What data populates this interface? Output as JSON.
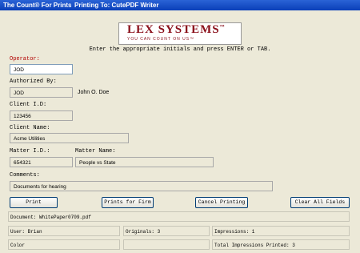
{
  "window": {
    "title": "The Count® For Prints",
    "printing_to": "Printing To: CutePDF Writer"
  },
  "logo": {
    "brand": "LEX SYSTEMS",
    "tm": "™",
    "tagline": "YOU CAN COUNT ON US™"
  },
  "instruction": "Enter the appropriate initials and press ENTER or TAB.",
  "form": {
    "operator": {
      "label": "Operator:",
      "value": "JOD"
    },
    "authorized_by": {
      "label": "Authorized By:",
      "value": "JOD",
      "name": "John O. Doe"
    },
    "client_id": {
      "label": "Client I.D:",
      "value": "123456"
    },
    "client_name": {
      "label": "Client Name:",
      "value": "Acme Utilities"
    },
    "matter_id": {
      "label": "Matter I.D.:",
      "value": "654321"
    },
    "matter_name": {
      "label": "Matter Name:",
      "value": "People vs State"
    },
    "comments": {
      "label": "Comments:",
      "value": "Documents for hearing"
    }
  },
  "buttons": {
    "print": "Print",
    "prints_for_firm": "Prints for Firm",
    "cancel_printing": "Cancel Printing",
    "clear_all_fields": "Clear All Fields"
  },
  "status": {
    "document": "Document: WhitePaper0709.pdf",
    "user": "User: Brian",
    "originals": "Originals: 3",
    "impressions": "Impressions: 1",
    "color": "Color",
    "total_impressions": "Total Impressions Printed: 3"
  },
  "colors": {
    "titlebar": "#0a3fb8",
    "background": "#ece9d8",
    "brand": "#8a0f1a",
    "operator_label": "#b30000"
  }
}
